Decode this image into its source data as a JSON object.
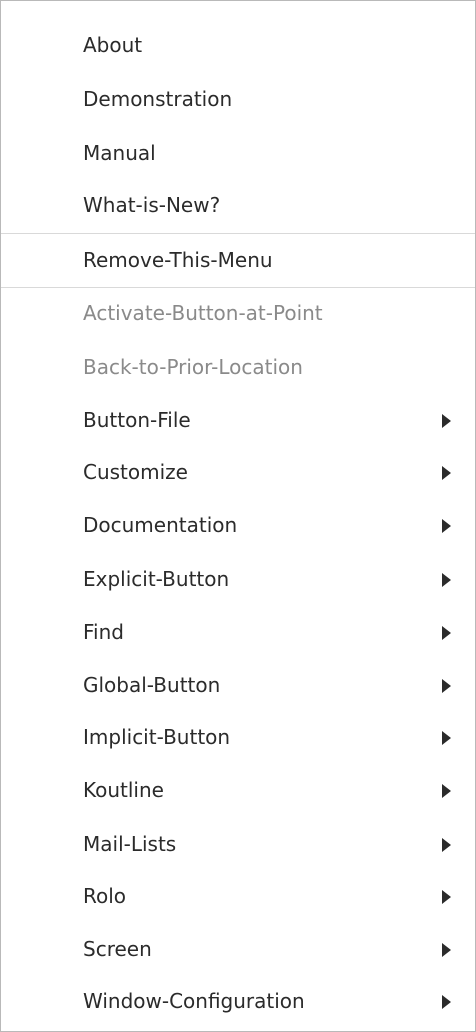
{
  "menu": {
    "items": [
      {
        "label": "About",
        "disabled": false,
        "submenu": false
      },
      {
        "label": "Demonstration",
        "disabled": false,
        "submenu": false
      },
      {
        "label": "Manual",
        "disabled": false,
        "submenu": false
      },
      {
        "label": "What-is-New?",
        "disabled": false,
        "submenu": false
      },
      {
        "label": "Remove-This-Menu",
        "disabled": false,
        "submenu": false
      },
      {
        "label": "Activate-Button-at-Point",
        "disabled": true,
        "submenu": false
      },
      {
        "label": "Back-to-Prior-Location",
        "disabled": true,
        "submenu": false
      },
      {
        "label": "Button-File",
        "disabled": false,
        "submenu": true
      },
      {
        "label": "Customize",
        "disabled": false,
        "submenu": true
      },
      {
        "label": "Documentation",
        "disabled": false,
        "submenu": true
      },
      {
        "label": "Explicit-Button",
        "disabled": false,
        "submenu": true
      },
      {
        "label": "Find",
        "disabled": false,
        "submenu": true
      },
      {
        "label": "Global-Button",
        "disabled": false,
        "submenu": true
      },
      {
        "label": "Implicit-Button",
        "disabled": false,
        "submenu": true
      },
      {
        "label": "Koutline",
        "disabled": false,
        "submenu": true
      },
      {
        "label": "Mail-Lists",
        "disabled": false,
        "submenu": true
      },
      {
        "label": "Rolo",
        "disabled": false,
        "submenu": true
      },
      {
        "label": "Screen",
        "disabled": false,
        "submenu": true
      },
      {
        "label": "Window-Configuration",
        "disabled": false,
        "submenu": true
      }
    ]
  },
  "colors": {
    "text": "#2b2b2b",
    "disabled_text": "#8a8a8a",
    "separator": "#d9d9d9",
    "border": "#b9b9b9"
  }
}
